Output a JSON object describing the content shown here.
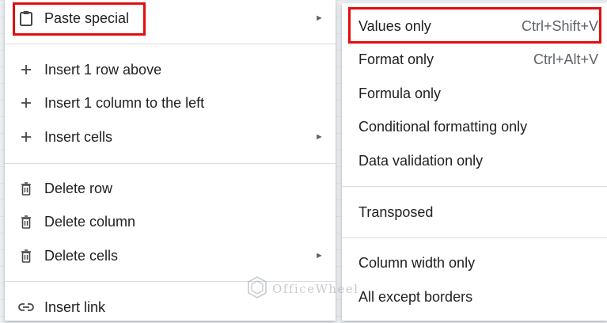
{
  "main_menu": {
    "paste_special": "Paste special",
    "insert_row_above": "Insert 1 row above",
    "insert_column_left": "Insert 1 column to the left",
    "insert_cells": "Insert cells",
    "delete_row": "Delete row",
    "delete_column": "Delete column",
    "delete_cells": "Delete cells",
    "insert_link": "Insert link",
    "submenu_arrow": "►"
  },
  "paste_special_menu": {
    "values_only": "Values only",
    "values_only_shortcut": "Ctrl+Shift+V",
    "format_only": "Format only",
    "format_only_shortcut": "Ctrl+Alt+V",
    "formula_only": "Formula only",
    "conditional_formatting_only": "Conditional formatting only",
    "data_validation_only": "Data validation only",
    "transposed": "Transposed",
    "column_width_only": "Column width only",
    "all_except_borders": "All except borders"
  },
  "watermark": "OfficeWheel",
  "colors": {
    "highlight_border": "#e30d0d",
    "divider": "#dadce0",
    "menu_bg": "#ffffff"
  },
  "icons": {
    "paste_special": "clipboard-icon",
    "insert": "plus-icon",
    "delete": "trash-icon",
    "link": "link-icon",
    "submenu": "triangle-right-icon"
  }
}
